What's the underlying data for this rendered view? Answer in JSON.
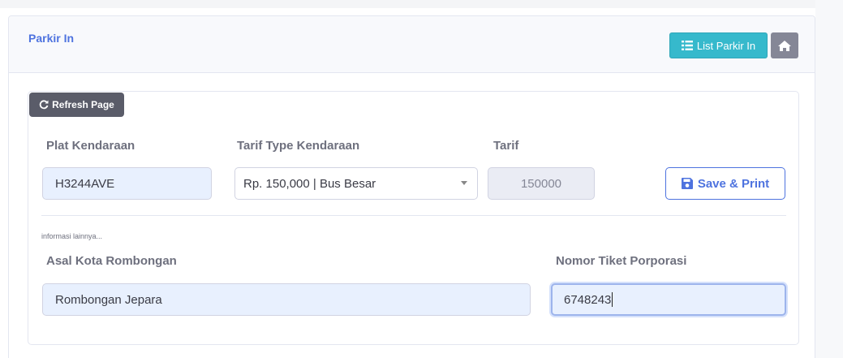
{
  "card": {
    "title": "Parkir In",
    "list_button_label": "List Parkir In",
    "home_button_icon": "home-icon"
  },
  "toolbar": {
    "refresh_label": "Refresh Page",
    "refresh_icon": "refresh-icon"
  },
  "form": {
    "plat": {
      "label": "Plat Kendaraan",
      "value": "H3244AVE"
    },
    "tarif_type": {
      "label": "Tarif Type Kendaraan",
      "selected": "Rp. 150,000 | Bus Besar"
    },
    "tarif": {
      "label": "Tarif",
      "value": "150000"
    },
    "save_label": "Save & Print",
    "save_icon": "save-icon",
    "note": "informasi lainnya...",
    "asal_kota": {
      "label": "Asal Kota Rombongan",
      "value": "Rombongan Jepara"
    },
    "nomor_tiket": {
      "label": "Nomor Tiket Porporasi",
      "value": "6748243"
    }
  },
  "colors": {
    "primary": "#4e73df",
    "info": "#36b9cc",
    "secondary": "#858796",
    "dark": "#5a5c69"
  }
}
